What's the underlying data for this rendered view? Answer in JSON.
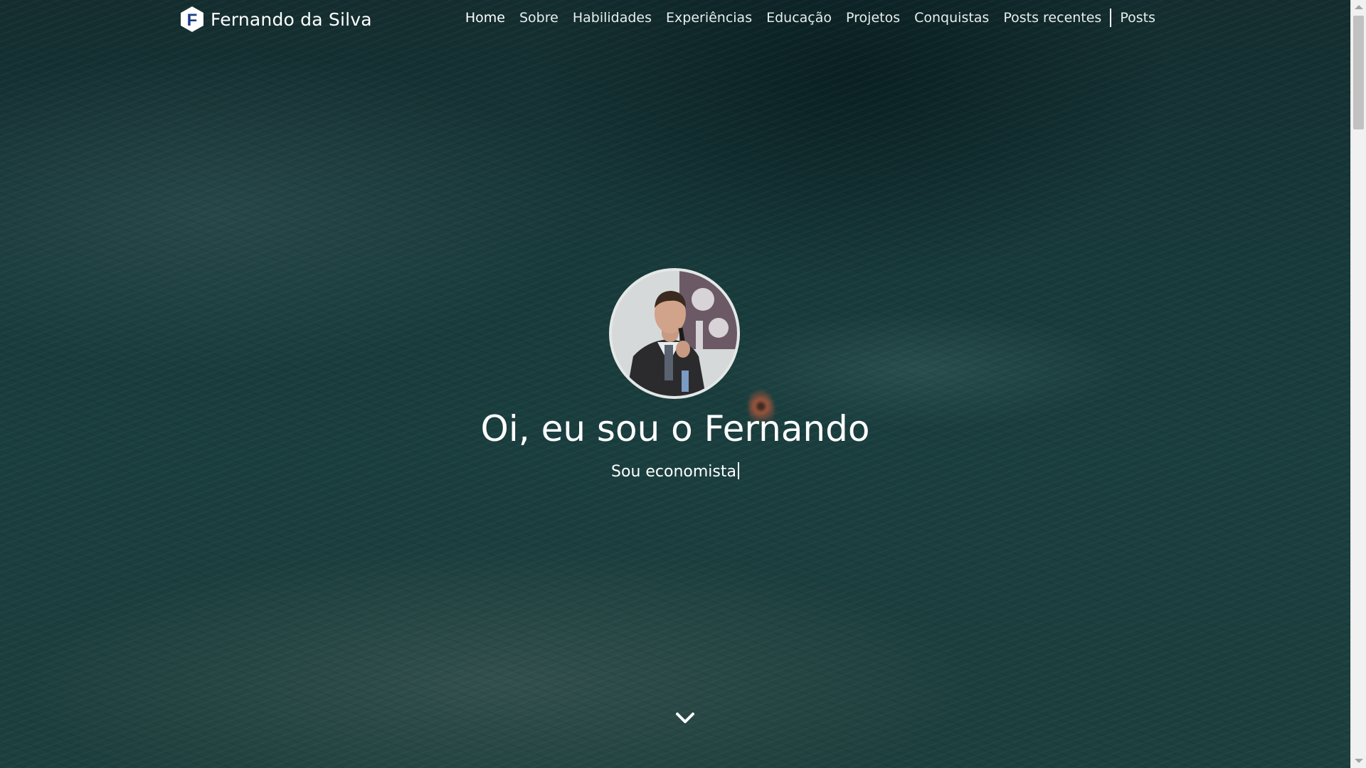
{
  "navbar": {
    "brand_letter": "F",
    "brand_name": "Fernando da Silva",
    "items": [
      {
        "label": "Home"
      },
      {
        "label": "Sobre"
      },
      {
        "label": "Habilidades"
      },
      {
        "label": "Experiências"
      },
      {
        "label": "Educação"
      },
      {
        "label": "Projetos"
      },
      {
        "label": "Conquistas"
      },
      {
        "label": "Posts recentes"
      },
      {
        "label": "Posts"
      }
    ]
  },
  "hero": {
    "title": "Oi, eu sou o Fernando",
    "subtitle": "Sou economista",
    "avatar_alt": "Fernando da Silva",
    "scroll_icon": "chevron-down-icon"
  },
  "colors": {
    "background": "#183a3b",
    "text": "#ffffff",
    "logo_blue": "#1e3a8a"
  }
}
